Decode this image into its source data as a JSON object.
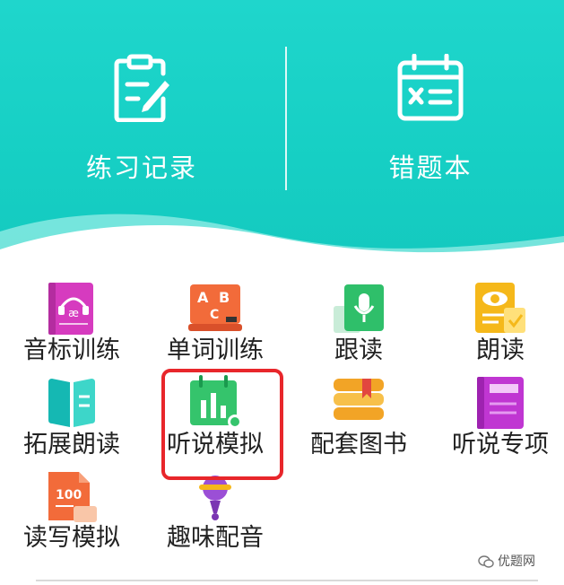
{
  "header": {
    "practice_label": "练习记录",
    "wrongbook_label": "错题本",
    "bg_color": "#16cfc4"
  },
  "grid": {
    "items": [
      {
        "label": "音标训练",
        "icon": "phonetic-book-icon"
      },
      {
        "label": "单词训练",
        "icon": "abc-blackboard-icon"
      },
      {
        "label": "跟读",
        "icon": "microphone-icon"
      },
      {
        "label": "朗读",
        "icon": "reading-eye-icon"
      },
      {
        "label": "拓展朗读",
        "icon": "open-book-icon"
      },
      {
        "label": "听说模拟",
        "icon": "bar-chart-calendar-icon"
      },
      {
        "label": "配套图书",
        "icon": "stacked-books-icon"
      },
      {
        "label": "听说专项",
        "icon": "purple-book-icon"
      },
      {
        "label": "读写模拟",
        "icon": "document-100-icon"
      },
      {
        "label": "趣味配音",
        "icon": "lollipop-mic-icon"
      }
    ],
    "highlight_color": "#e8262b"
  },
  "watermark": {
    "text": "优题网"
  }
}
